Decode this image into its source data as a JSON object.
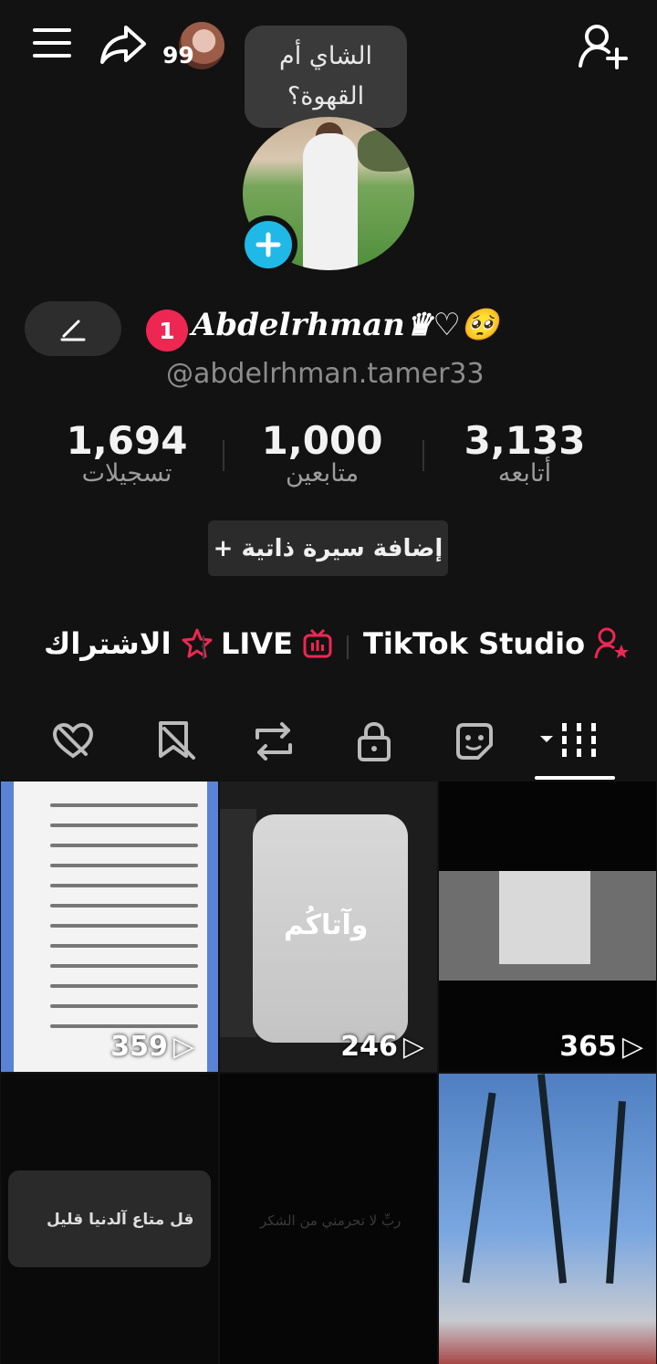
{
  "top_bar": {
    "notification_count": "99",
    "icons": [
      "menu-icon",
      "share-icon",
      "add-friend-icon"
    ]
  },
  "note": {
    "text": "الشاي أم القهوة؟"
  },
  "profile": {
    "badge": "1",
    "display_name": "𝑨𝒃𝒅𝒆𝒍𝒓𝒉𝒎𝒂𝒏♛♡🥺",
    "username": "@abdelrhman.tamer33"
  },
  "stats": {
    "recordings": {
      "value": "1,694",
      "label": "تسجيلات"
    },
    "followers": {
      "value": "1,000",
      "label": "متابعين"
    },
    "following": {
      "value": "3,133",
      "label": "أتابعه"
    }
  },
  "bio_button": "+ إضافة سيرة ذاتية",
  "links": {
    "subscription": "الاشتراك",
    "live": "LIVE",
    "studio": "TikTok Studio"
  },
  "tabs": [
    "grid",
    "face",
    "lock",
    "repost",
    "favorites",
    "liked"
  ],
  "videos": [
    {
      "views": "359"
    },
    {
      "views": "246",
      "overlay_text": "وآتاكُم"
    },
    {
      "views": "365"
    },
    {
      "overlay_text": "قل متاع آلدنيا قليل"
    },
    {
      "overlay_text": "ربِّ لا تحرمني من الشكر"
    },
    {}
  ],
  "colors": {
    "accent": "#ee2752",
    "add_photo": "#20b8e6",
    "background": "#121212"
  }
}
